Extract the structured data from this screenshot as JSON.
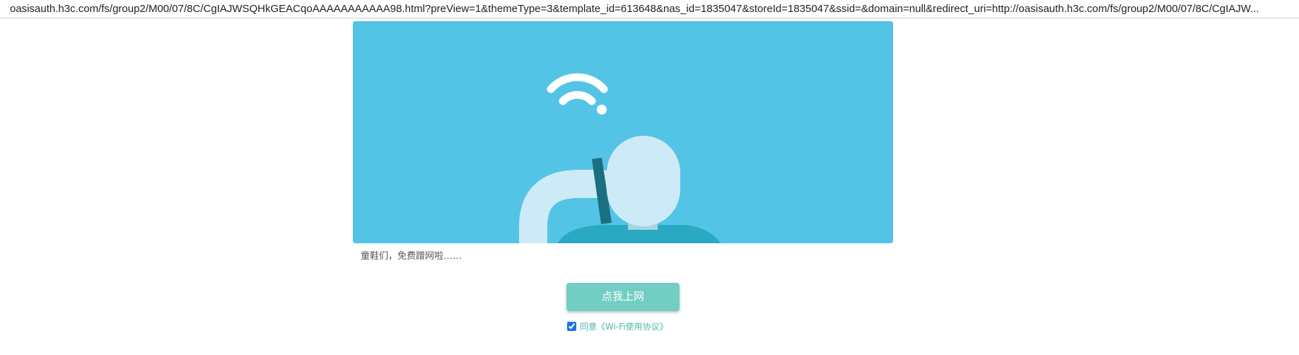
{
  "browser": {
    "url": "oasisauth.h3c.com/fs/group2/M00/07/8C/CgIAJWSQHkGEACqoAAAAAAAAAAA98.html?preView=1&themeType=3&template_id=613648&nas_id=1835047&storeId=1835047&ssid=&domain=null&redirect_uri=http://oasisauth.h3c.com/fs/group2/M00/07/8C/CgIAJW..."
  },
  "banner": {
    "background_color": "#53c4e6",
    "icons": [
      "wifi-icon",
      "person-illustration"
    ]
  },
  "caption": {
    "text": "童鞋们，免费蹭网啦……"
  },
  "connect_button": {
    "label": "点我上网",
    "color": "#72cec2"
  },
  "agreement": {
    "checked": true,
    "text": "同意《Wi-Fi使用协议》"
  }
}
